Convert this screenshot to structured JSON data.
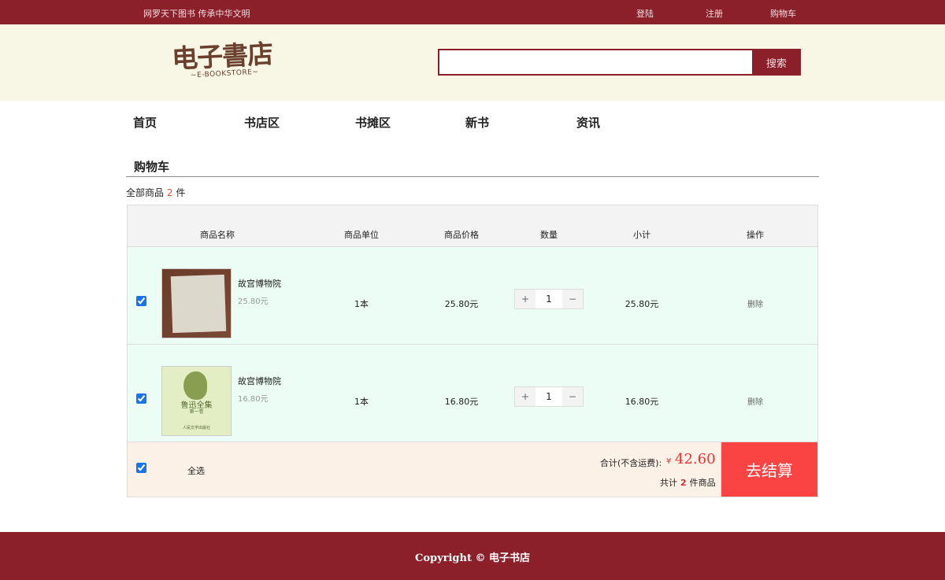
{
  "topbar": {
    "slogan": "网罗天下图书  传承中华文明",
    "login": "登陆",
    "register": "注册",
    "cart": "购物车"
  },
  "header": {
    "logo_cn": "电子書店",
    "logo_en": "~E-BOOKSTORE~",
    "search_value": "",
    "search_button": "搜索"
  },
  "nav": [
    "首页",
    "书店区",
    "书摊区",
    "新书",
    "资讯"
  ],
  "cart": {
    "title": "购物车",
    "count_prefix": "全部商品",
    "count": "2",
    "count_suffix": "件",
    "columns": [
      "商品名称",
      "商品单位",
      "商品价格",
      "数量",
      "小计",
      "操作"
    ],
    "items": [
      {
        "name": "故宫博物院",
        "unit_price": "25.80元",
        "unit": "1本",
        "price": "25.80元",
        "quantity": "1",
        "subtotal": "25.80元",
        "delete": "删除",
        "checked": true
      },
      {
        "name": "故宫博物院",
        "unit_price": "16.80元",
        "unit": "1本",
        "price": "16.80元",
        "quantity": "1",
        "subtotal": "16.80元",
        "delete": "删除",
        "checked": true,
        "cover_title": "鲁迅全集",
        "cover_sub": "第一卷",
        "cover_pub": "人民文学出版社"
      }
    ],
    "stepper_plus": "+",
    "stepper_minus": "−",
    "select_all": "全选",
    "total_label": "合计(不含运费):",
    "currency": "¥",
    "total": "42.60",
    "total_count_prefix": "共计",
    "total_count": "2",
    "total_count_suffix": "件商品",
    "checkout": "去结算"
  },
  "footer": {
    "copyright": "Copyright © 电子书店"
  },
  "colors": {
    "brand": "#8b1f2a",
    "header_bg": "#f8f7e6",
    "row_bg": "#ebfdf4",
    "summary_bg": "#fbf1e6",
    "checkout_bg": "#fa4343",
    "price_red": "#e33"
  }
}
